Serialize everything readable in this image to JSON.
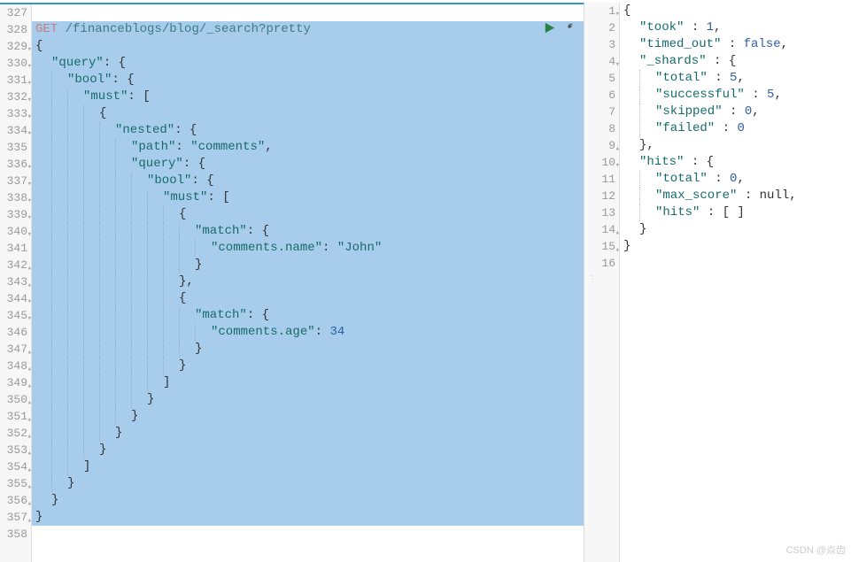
{
  "watermark": "CSDN @焱齿",
  "left": {
    "firstLine": 327,
    "actions": {
      "run": "run-icon",
      "wrench": "wrench-icon"
    },
    "request": {
      "method": "GET",
      "path": "/financeblogs/blog/_search?pretty"
    },
    "lines": [
      {
        "n": 327,
        "plain": ""
      },
      {
        "n": 328,
        "sel": true,
        "method": "GET",
        "path": " /financeblogs/blog/_search?pretty"
      },
      {
        "n": 329,
        "sel": true,
        "fold": true,
        "ind": 0,
        "tokens": [
          [
            "p",
            "{"
          ]
        ]
      },
      {
        "n": 330,
        "sel": true,
        "fold": true,
        "ind": 1,
        "tokens": [
          [
            "k",
            "\"query\""
          ],
          [
            "p",
            ": {"
          ]
        ]
      },
      {
        "n": 331,
        "sel": true,
        "fold": true,
        "ind": 2,
        "tokens": [
          [
            "k",
            "\"bool\""
          ],
          [
            "p",
            ": {"
          ]
        ]
      },
      {
        "n": 332,
        "sel": true,
        "fold": true,
        "ind": 3,
        "tokens": [
          [
            "k",
            "\"must\""
          ],
          [
            "p",
            ": ["
          ]
        ]
      },
      {
        "n": 333,
        "sel": true,
        "fold": true,
        "ind": 4,
        "tokens": [
          [
            "p",
            "{"
          ]
        ]
      },
      {
        "n": 334,
        "sel": true,
        "fold": true,
        "ind": 5,
        "tokens": [
          [
            "k",
            "\"nested\""
          ],
          [
            "p",
            ": {"
          ]
        ]
      },
      {
        "n": 335,
        "sel": true,
        "ind": 6,
        "tokens": [
          [
            "k",
            "\"path\""
          ],
          [
            "p",
            ": "
          ],
          [
            "s",
            "\"comments\""
          ],
          [
            "p",
            ","
          ]
        ]
      },
      {
        "n": 336,
        "sel": true,
        "fold": true,
        "ind": 6,
        "tokens": [
          [
            "k",
            "\"query\""
          ],
          [
            "p",
            ": {"
          ]
        ]
      },
      {
        "n": 337,
        "sel": true,
        "fold": true,
        "ind": 7,
        "tokens": [
          [
            "k",
            "\"bool\""
          ],
          [
            "p",
            ": {"
          ]
        ]
      },
      {
        "n": 338,
        "sel": true,
        "fold": true,
        "ind": 8,
        "tokens": [
          [
            "k",
            "\"must\""
          ],
          [
            "p",
            ": ["
          ]
        ]
      },
      {
        "n": 339,
        "sel": true,
        "fold": true,
        "ind": 9,
        "tokens": [
          [
            "p",
            "{"
          ]
        ]
      },
      {
        "n": 340,
        "sel": true,
        "fold": true,
        "ind": 10,
        "tokens": [
          [
            "k",
            "\"match\""
          ],
          [
            "p",
            ": {"
          ]
        ]
      },
      {
        "n": 341,
        "sel": true,
        "ind": 11,
        "tokens": [
          [
            "k",
            "\"comments.name\""
          ],
          [
            "p",
            ": "
          ],
          [
            "s",
            "\"John\""
          ]
        ]
      },
      {
        "n": 342,
        "sel": true,
        "foldend": true,
        "ind": 10,
        "tokens": [
          [
            "p",
            "}"
          ]
        ]
      },
      {
        "n": 343,
        "sel": true,
        "foldend": true,
        "ind": 9,
        "tokens": [
          [
            "p",
            "},"
          ]
        ]
      },
      {
        "n": 344,
        "sel": true,
        "fold": true,
        "ind": 9,
        "tokens": [
          [
            "p",
            "{"
          ]
        ]
      },
      {
        "n": 345,
        "sel": true,
        "fold": true,
        "ind": 10,
        "tokens": [
          [
            "k",
            "\"match\""
          ],
          [
            "p",
            ": {"
          ]
        ]
      },
      {
        "n": 346,
        "sel": true,
        "ind": 11,
        "tokens": [
          [
            "k",
            "\"comments.age\""
          ],
          [
            "p",
            ": "
          ],
          [
            "n",
            "34"
          ]
        ]
      },
      {
        "n": 347,
        "sel": true,
        "foldend": true,
        "ind": 10,
        "tokens": [
          [
            "p",
            "}"
          ]
        ]
      },
      {
        "n": 348,
        "sel": true,
        "foldend": true,
        "ind": 9,
        "tokens": [
          [
            "p",
            "}"
          ]
        ]
      },
      {
        "n": 349,
        "sel": true,
        "foldend": true,
        "ind": 8,
        "tokens": [
          [
            "p",
            "]"
          ]
        ]
      },
      {
        "n": 350,
        "sel": true,
        "foldend": true,
        "ind": 7,
        "tokens": [
          [
            "p",
            "}"
          ]
        ]
      },
      {
        "n": 351,
        "sel": true,
        "foldend": true,
        "ind": 6,
        "tokens": [
          [
            "p",
            "}"
          ]
        ]
      },
      {
        "n": 352,
        "sel": true,
        "foldend": true,
        "ind": 5,
        "tokens": [
          [
            "p",
            "}"
          ]
        ]
      },
      {
        "n": 353,
        "sel": true,
        "foldend": true,
        "ind": 4,
        "tokens": [
          [
            "p",
            "}"
          ]
        ]
      },
      {
        "n": 354,
        "sel": true,
        "foldend": true,
        "ind": 3,
        "tokens": [
          [
            "p",
            "]"
          ]
        ]
      },
      {
        "n": 355,
        "sel": true,
        "foldend": true,
        "ind": 2,
        "tokens": [
          [
            "p",
            "}"
          ]
        ]
      },
      {
        "n": 356,
        "sel": true,
        "foldend": true,
        "ind": 1,
        "tokens": [
          [
            "p",
            "}"
          ]
        ]
      },
      {
        "n": 357,
        "sel": true,
        "foldend": true,
        "ind": 0,
        "tokens": [
          [
            "p",
            "}"
          ]
        ]
      },
      {
        "n": 358,
        "plain": ""
      }
    ]
  },
  "right": {
    "response": {
      "took": 1,
      "timed_out": false,
      "_shards": {
        "total": 5,
        "successful": 5,
        "skipped": 0,
        "failed": 0
      },
      "hits": {
        "total": 0,
        "max_score": null,
        "hits": []
      }
    },
    "lines": [
      {
        "n": 1,
        "fold": true,
        "ind": 0,
        "tokens": [
          [
            "p",
            "{"
          ]
        ]
      },
      {
        "n": 2,
        "ind": 1,
        "tokens": [
          [
            "k",
            "\"took\""
          ],
          [
            "p",
            " : "
          ],
          [
            "n",
            "1"
          ],
          [
            "p",
            ","
          ]
        ]
      },
      {
        "n": 3,
        "ind": 1,
        "tokens": [
          [
            "k",
            "\"timed_out\""
          ],
          [
            "p",
            " : "
          ],
          [
            "kw",
            "false"
          ],
          [
            "p",
            ","
          ]
        ]
      },
      {
        "n": 4,
        "fold": true,
        "ind": 1,
        "tokens": [
          [
            "k",
            "\"_shards\""
          ],
          [
            "p",
            " : {"
          ]
        ]
      },
      {
        "n": 5,
        "ind": 2,
        "tokens": [
          [
            "k",
            "\"total\""
          ],
          [
            "p",
            " : "
          ],
          [
            "n",
            "5"
          ],
          [
            "p",
            ","
          ]
        ]
      },
      {
        "n": 6,
        "ind": 2,
        "tokens": [
          [
            "k",
            "\"successful\""
          ],
          [
            "p",
            " : "
          ],
          [
            "n",
            "5"
          ],
          [
            "p",
            ","
          ]
        ]
      },
      {
        "n": 7,
        "ind": 2,
        "tokens": [
          [
            "k",
            "\"skipped\""
          ],
          [
            "p",
            " : "
          ],
          [
            "n",
            "0"
          ],
          [
            "p",
            ","
          ]
        ]
      },
      {
        "n": 8,
        "ind": 2,
        "tokens": [
          [
            "k",
            "\"failed\""
          ],
          [
            "p",
            " : "
          ],
          [
            "n",
            "0"
          ]
        ]
      },
      {
        "n": 9,
        "foldend": true,
        "ind": 1,
        "tokens": [
          [
            "p",
            "},"
          ]
        ]
      },
      {
        "n": 10,
        "fold": true,
        "ind": 1,
        "tokens": [
          [
            "k",
            "\"hits\""
          ],
          [
            "p",
            " : {"
          ]
        ]
      },
      {
        "n": 11,
        "ind": 2,
        "tokens": [
          [
            "k",
            "\"total\""
          ],
          [
            "p",
            " : "
          ],
          [
            "n",
            "0"
          ],
          [
            "p",
            ","
          ]
        ]
      },
      {
        "n": 12,
        "ind": 2,
        "tokens": [
          [
            "k",
            "\"max_score\""
          ],
          [
            "p",
            " : "
          ],
          [
            "null",
            "null"
          ],
          [
            "p",
            ","
          ]
        ]
      },
      {
        "n": 13,
        "ind": 2,
        "tokens": [
          [
            "k",
            "\"hits\""
          ],
          [
            "p",
            " : [ ]"
          ]
        ]
      },
      {
        "n": 14,
        "foldend": true,
        "ind": 1,
        "tokens": [
          [
            "p",
            "}"
          ]
        ]
      },
      {
        "n": 15,
        "foldend": true,
        "ind": 0,
        "tokens": [
          [
            "p",
            "}"
          ]
        ]
      },
      {
        "n": 16,
        "plain": ""
      }
    ]
  }
}
